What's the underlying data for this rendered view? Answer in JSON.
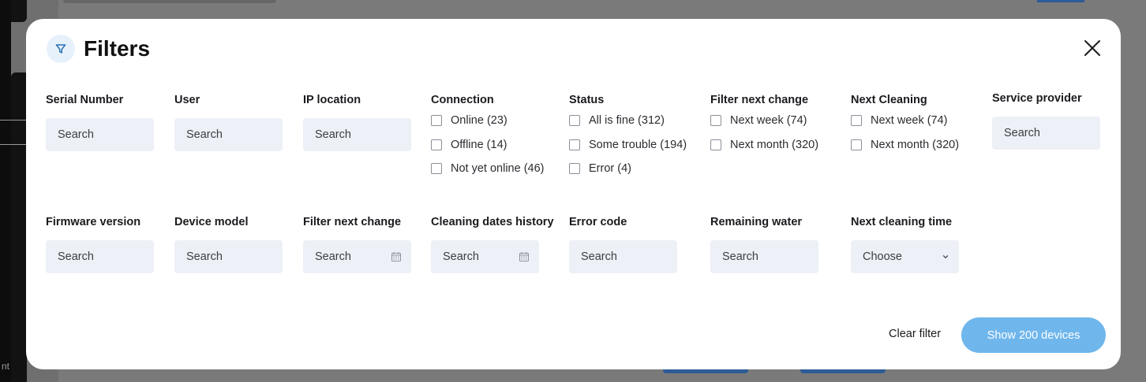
{
  "modal": {
    "title": "Filters",
    "title_icon": "funnel-icon",
    "close_icon": "close-icon"
  },
  "row1": {
    "serial_number": {
      "label": "Serial Number",
      "placeholder": "Search"
    },
    "user": {
      "label": "User",
      "placeholder": "Search"
    },
    "ip_location": {
      "label": "IP location",
      "placeholder": "Search"
    },
    "connection": {
      "label": "Connection",
      "options": [
        "Online (23)",
        "Offline (14)",
        "Not yet online (46)"
      ]
    },
    "status": {
      "label": "Status",
      "options": [
        "All is fine (312)",
        "Some trouble (194)",
        "Error (4)"
      ]
    },
    "filter_next_change": {
      "label": "Filter next change",
      "options": [
        "Next week (74)",
        "Next month (320)"
      ]
    },
    "next_cleaning": {
      "label": "Next Cleaning",
      "options": [
        "Next week (74)",
        "Next month (320)"
      ]
    },
    "service_provider": {
      "label": "Service provider",
      "placeholder": "Search"
    }
  },
  "row2": {
    "firmware_version": {
      "label": "Firmware version",
      "placeholder": "Search"
    },
    "device_model": {
      "label": "Device model",
      "placeholder": "Search"
    },
    "filter_next_change": {
      "label": "Filter next change",
      "placeholder": "Search",
      "icon": "calendar-icon"
    },
    "cleaning_dates_history": {
      "label": "Cleaning dates history",
      "placeholder": "Search",
      "icon": "calendar-icon"
    },
    "error_code": {
      "label": "Error code",
      "placeholder": "Search"
    },
    "remaining_water": {
      "label": "Remaining water",
      "placeholder": "Search"
    },
    "next_cleaning_time": {
      "label": "Next cleaning time",
      "selected": "Choose",
      "icon": "chevron-down-icon"
    }
  },
  "footer": {
    "clear_label": "Clear filter",
    "show_label": "Show 200 devices"
  },
  "colors": {
    "accent": "#6fb6ec",
    "field_bg": "#edf0f6",
    "icon_bg": "#e6f1fb",
    "icon_stroke": "#2a6fb0"
  },
  "backdrop": {
    "sidebar_text": "nt"
  }
}
